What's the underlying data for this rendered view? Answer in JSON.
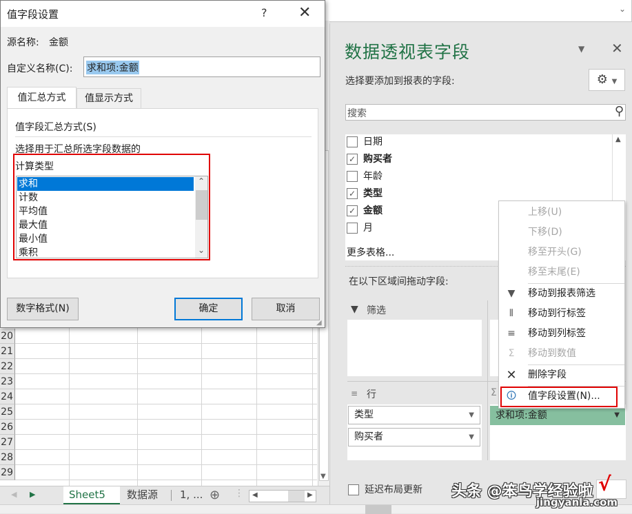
{
  "dialog": {
    "title": "值字段设置",
    "help": "?",
    "close": "✕",
    "source_label": "源名称:",
    "source_value": "金额",
    "custom_name_label": "自定义名称(C):",
    "custom_name_value": "求和项:金额",
    "tabs": [
      {
        "label": "值汇总方式",
        "active": true
      },
      {
        "label": "值显示方式",
        "active": false
      }
    ],
    "summarize_by_label": "值字段汇总方式(S)",
    "instruction_line1": "选择用于汇总所选字段数据的",
    "instruction_line2": "计算类型",
    "calc_types": [
      "求和",
      "计数",
      "平均值",
      "最大值",
      "最小值",
      "乘积"
    ],
    "selected_calc_type": "求和",
    "number_format_button": "数字格式(N)",
    "ok_button": "确定",
    "cancel_button": "取消"
  },
  "sheet": {
    "row_numbers": [
      "20",
      "21",
      "22",
      "23",
      "24",
      "25",
      "26",
      "27",
      "28",
      "29"
    ],
    "tabs": [
      "Sheet5",
      "数据源",
      "1, ..."
    ],
    "active_tab": "Sheet5"
  },
  "pivot_pane": {
    "title": "数据透视表字段",
    "subtitle": "选择要添加到报表的字段:",
    "search_placeholder": "搜索",
    "fields": [
      {
        "name": "日期",
        "checked": false
      },
      {
        "name": "购买者",
        "checked": true
      },
      {
        "name": "年龄",
        "checked": false
      },
      {
        "name": "类型",
        "checked": true
      },
      {
        "name": "金额",
        "checked": true
      },
      {
        "name": "月",
        "checked": false
      }
    ],
    "more_tables": "更多表格...",
    "drag_label": "在以下区域间拖动字段:",
    "filter_label": "筛选",
    "rows_label": "行",
    "row_fields": [
      "类型",
      "购买者"
    ],
    "value_fields": [
      "求和项:金额"
    ],
    "defer_label": "延迟布局更新",
    "value_field_color": "#86bf9f"
  },
  "context_menu": {
    "items": [
      {
        "label": "上移(U)",
        "enabled": false,
        "icon": ""
      },
      {
        "label": "下移(D)",
        "enabled": false,
        "icon": ""
      },
      {
        "label": "移至开头(G)",
        "enabled": false,
        "icon": ""
      },
      {
        "label": "移至末尾(E)",
        "enabled": false,
        "icon": ""
      },
      {
        "label": "移动到报表筛选",
        "enabled": true,
        "icon": "filter-icon"
      },
      {
        "label": "移动到行标签",
        "enabled": true,
        "icon": "row-labels-icon"
      },
      {
        "label": "移动到列标签",
        "enabled": true,
        "icon": "column-labels-icon"
      },
      {
        "label": "移动到数值",
        "enabled": false,
        "icon": "sigma-icon"
      },
      {
        "label": "删除字段",
        "enabled": true,
        "icon": "delete-icon"
      },
      {
        "label": "值字段设置(N)...",
        "enabled": true,
        "icon": "field-settings-icon"
      }
    ]
  },
  "watermark": {
    "line1": "头条 @笨鸟学经验啦",
    "line2": "jingyanla.com"
  },
  "highlight_color": "#e00000",
  "accent_color": "#217346"
}
